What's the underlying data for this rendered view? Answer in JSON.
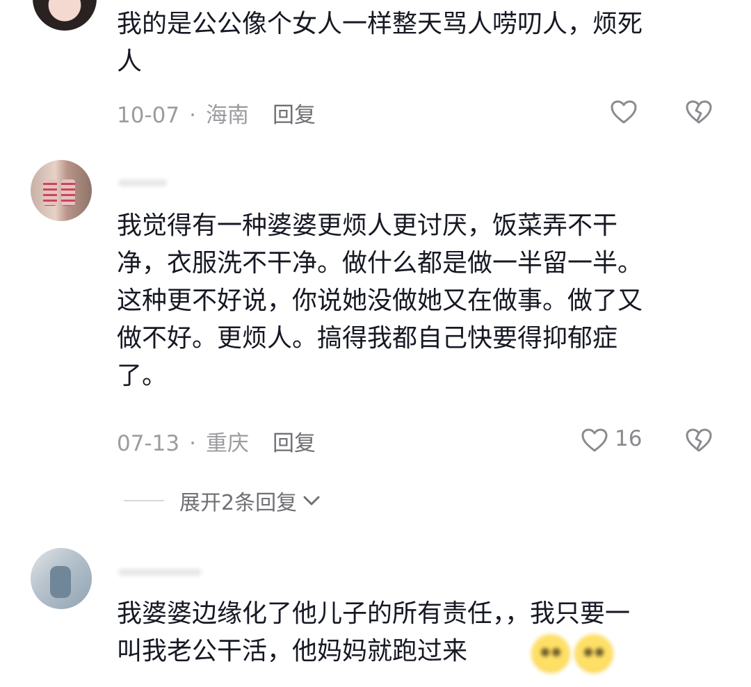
{
  "comments": [
    {
      "lines": [
        "我的是公公像个女人一样整天骂人唠叨人，烦死",
        "人"
      ],
      "date": "10-07",
      "location": "海南",
      "reply_label": "回复",
      "like_count": ""
    },
    {
      "lines": [
        "我觉得有一种婆婆更烦人更讨厌，饭菜弄不干",
        "净，衣服洗不干净。做什么都是做一半留一半。",
        "这种更不好说，你说她没做她又在做事。做了又",
        "做不好。更烦人。搞得我都自己快要得抑郁症",
        "了。"
      ],
      "date": "07-13",
      "location": "重庆",
      "reply_label": "回复",
      "like_count": "16",
      "expand_label": "展开2条回复"
    },
    {
      "lines": [
        "我婆婆边缘化了他儿子的所有责任，，我只要一",
        "叫我老公干活，他妈妈就跑过来"
      ]
    }
  ],
  "meta_separator": "·",
  "icons": [
    "heart-outline-icon",
    "broken-heart-icon",
    "chevron-down-icon"
  ],
  "colors": {
    "text": "#161823",
    "meta": "#9b9ba0",
    "icon": "#8a8a8f"
  }
}
